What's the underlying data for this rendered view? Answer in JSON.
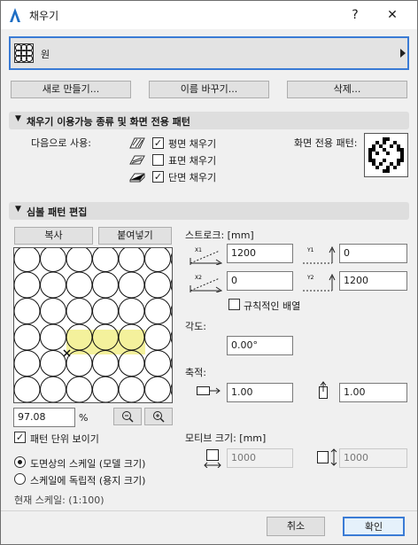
{
  "window": {
    "title": "채우기",
    "help_label": "?",
    "close_label": "✕"
  },
  "fill_selector": {
    "name": "원"
  },
  "top_buttons": {
    "new": "새로 만들기...",
    "rename": "이름 바꾸기...",
    "delete": "삭제..."
  },
  "section_availability": {
    "title": "채우기 이용가능 종류 및 화면 전용 패턴",
    "use_as_label": "다음으로 사용:",
    "options": [
      {
        "label": "평면 채우기",
        "checked": true
      },
      {
        "label": "표면 채우기",
        "checked": false
      },
      {
        "label": "단면 채우기",
        "checked": true
      }
    ],
    "screen_pattern_label": "화면 전용 패턴:"
  },
  "section_edit": {
    "title": "심볼 패턴 편집",
    "copy_button": "복사",
    "paste_button": "붙여넣기",
    "zoom_value": "97.08",
    "zoom_unit": "%",
    "show_tile_label": "패턴 단위 보이기",
    "show_tile_checked": true,
    "scale_options": [
      {
        "label": "도면상의 스케일 (모델 크기)",
        "selected": true
      },
      {
        "label": "스케일에 독립적 (용지 크기)",
        "selected": false
      }
    ],
    "current_scale": "현재 스케일: (1:100)",
    "stroke_label": "스트로크: [mm]",
    "x1_value": "1200",
    "y1_value": "0",
    "x2_value": "0",
    "y2_value": "1200",
    "regular_layout_label": "규칙적인 배열",
    "regular_layout_checked": false,
    "angle_label": "각도:",
    "angle_value": "0.00°",
    "scale_label": "축적:",
    "scale_x_value": "1.00",
    "scale_y_value": "1.00",
    "motif_label": "모티브 크기: [mm]",
    "motif_w_value": "1000",
    "motif_h_value": "1000"
  },
  "footer": {
    "cancel": "취소",
    "ok": "확인"
  },
  "colors": {
    "accent": "#3a7bd5",
    "highlight": "#f4f19c"
  }
}
